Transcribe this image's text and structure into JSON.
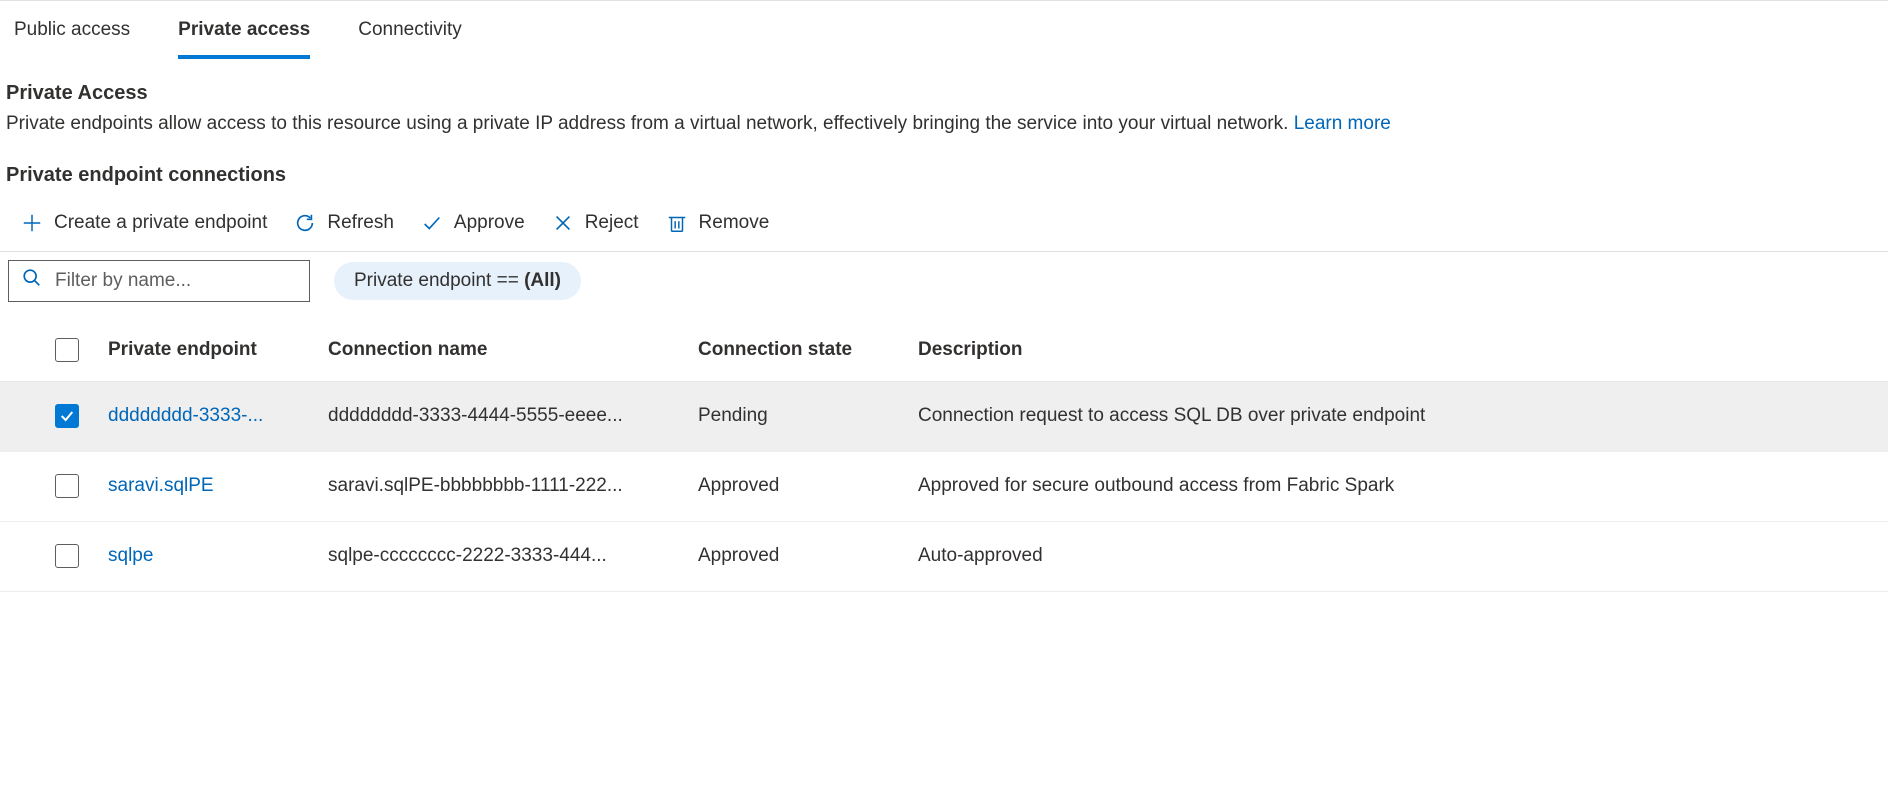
{
  "tabs": [
    {
      "label": "Public access",
      "active": false
    },
    {
      "label": "Private access",
      "active": true
    },
    {
      "label": "Connectivity",
      "active": false
    }
  ],
  "section": {
    "title": "Private Access",
    "description": "Private endpoints allow access to this resource using a private IP address from a virtual network, effectively bringing the service into your virtual network. ",
    "learn_more": "Learn more"
  },
  "subsection_title": "Private endpoint connections",
  "toolbar": {
    "create": "Create a private endpoint",
    "refresh": "Refresh",
    "approve": "Approve",
    "reject": "Reject",
    "remove": "Remove"
  },
  "filter": {
    "search_placeholder": "Filter by name...",
    "pill_prefix": "Private endpoint == ",
    "pill_value": "(All)"
  },
  "table": {
    "headers": {
      "endpoint": "Private endpoint",
      "connection_name": "Connection name",
      "connection_state": "Connection state",
      "description": "Description"
    },
    "rows": [
      {
        "selected": true,
        "endpoint": "dddddddd-3333-...",
        "connection_name": "dddddddd-3333-4444-5555-eeee...",
        "connection_state": "Pending",
        "description": "Connection request to access SQL DB over private endpoint"
      },
      {
        "selected": false,
        "endpoint": "saravi.sqlPE",
        "connection_name": "saravi.sqlPE-bbbbbbbb-1111-222...",
        "connection_state": "Approved",
        "description": "Approved for secure outbound access from Fabric Spark"
      },
      {
        "selected": false,
        "endpoint": "sqlpe",
        "connection_name": "sqlpe-cccccccc-2222-3333-444...",
        "connection_state": "Approved",
        "description": "Auto-approved"
      }
    ]
  }
}
